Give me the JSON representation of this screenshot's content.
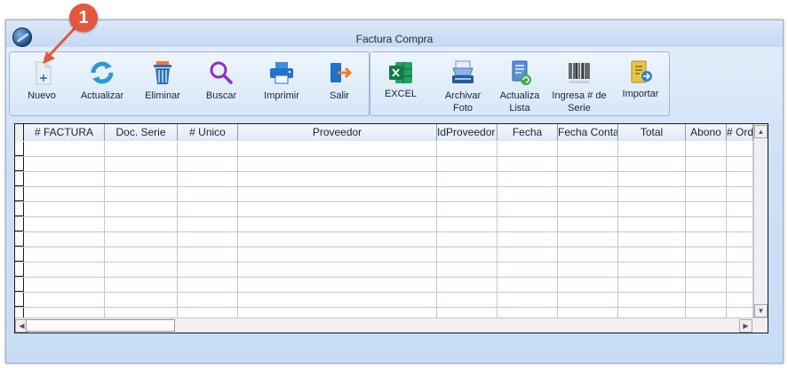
{
  "window": {
    "title": "Factura Compra"
  },
  "callout": {
    "number": "1"
  },
  "toolbar": {
    "group1": [
      {
        "label": "Nuevo",
        "icon": "new-document-icon"
      },
      {
        "label": "Actualizar",
        "icon": "refresh-icon"
      },
      {
        "label": "Eliminar",
        "icon": "trash-icon"
      },
      {
        "label": "Buscar",
        "icon": "search-icon"
      },
      {
        "label": "Imprimir",
        "icon": "printer-icon"
      },
      {
        "label": "Salir",
        "icon": "exit-icon"
      }
    ],
    "group2": [
      {
        "label": "EXCEL",
        "icon": "excel-icon"
      },
      {
        "label": "Archivar\nFoto",
        "icon": "scanner-icon"
      },
      {
        "label": "Actualiza\nLista",
        "icon": "update-list-icon"
      },
      {
        "label": "Ingresa # de\nSerie",
        "icon": "barcode-icon"
      },
      {
        "label": "Importar",
        "icon": "import-icon"
      }
    ]
  },
  "grid": {
    "columns": [
      "# FACTURA",
      "Doc. Serie",
      "# Unico",
      "Proveedor",
      "IdProveedor",
      "Fecha",
      "Fecha Conta",
      "Total",
      "Abono",
      "# Ord"
    ],
    "row_count": 12
  },
  "colors": {
    "accent": "#e4573c",
    "grid_line": "#b7c9e6",
    "window_bg": "#c7dcf4"
  }
}
